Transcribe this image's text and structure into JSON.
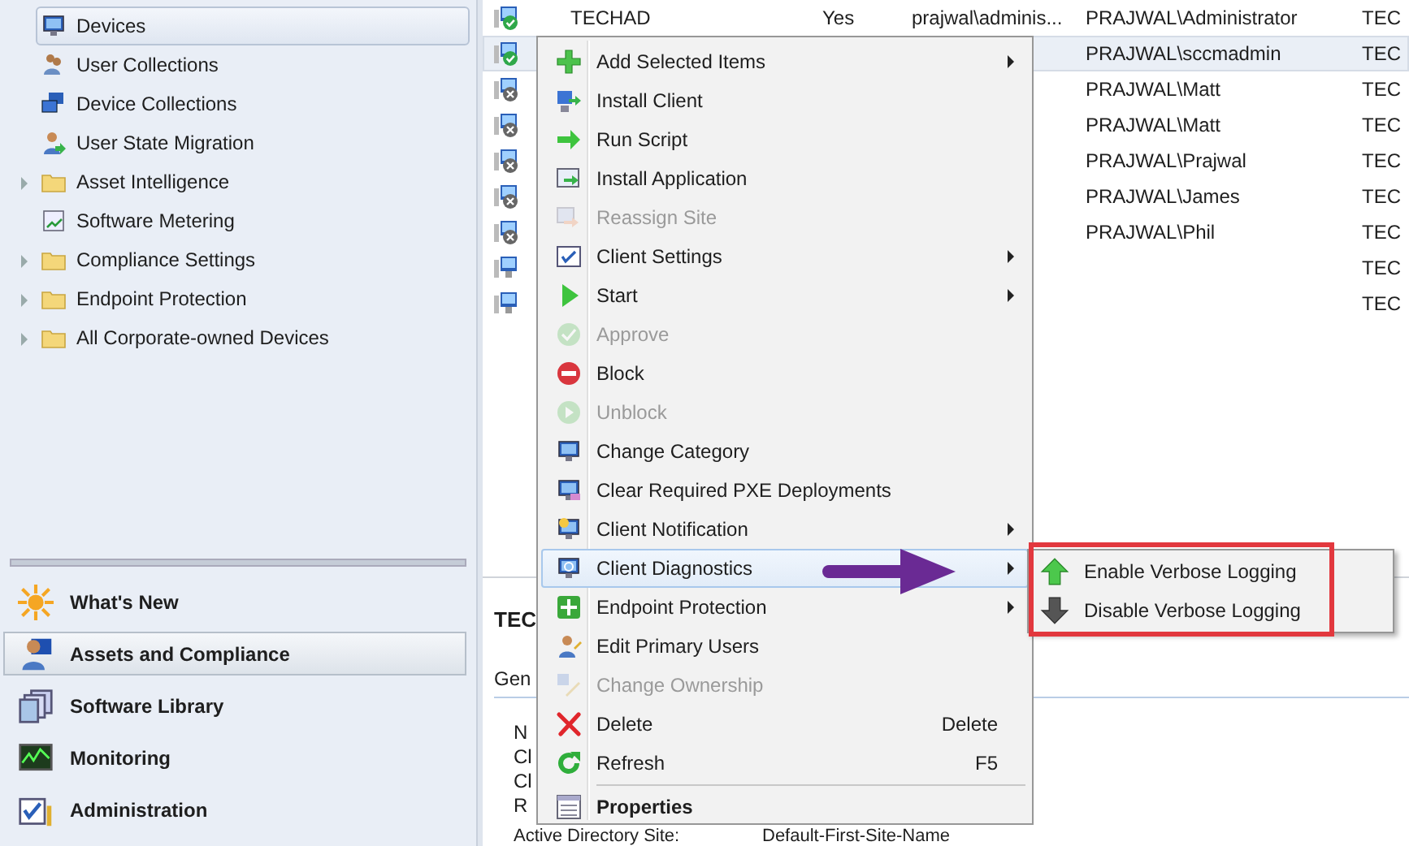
{
  "tree": [
    {
      "label": "Devices",
      "selected": true,
      "expandable": false
    },
    {
      "label": "User Collections",
      "selected": false,
      "expandable": false
    },
    {
      "label": "Device Collections",
      "selected": false,
      "expandable": false
    },
    {
      "label": "User State Migration",
      "selected": false,
      "expandable": false
    },
    {
      "label": "Asset Intelligence",
      "selected": false,
      "expandable": true
    },
    {
      "label": "Software Metering",
      "selected": false,
      "expandable": false
    },
    {
      "label": "Compliance Settings",
      "selected": false,
      "expandable": true
    },
    {
      "label": "Endpoint Protection",
      "selected": false,
      "expandable": true
    },
    {
      "label": "All Corporate-owned Devices",
      "selected": false,
      "expandable": true
    }
  ],
  "workspaces": [
    {
      "label": "What's New",
      "selected": false
    },
    {
      "label": "Assets and Compliance",
      "selected": true
    },
    {
      "label": "Software Library",
      "selected": false
    },
    {
      "label": "Monitoring",
      "selected": false
    },
    {
      "label": "Administration",
      "selected": false
    }
  ],
  "table": {
    "rows": [
      {
        "kind": "ok",
        "selected": false,
        "column_1": "TECHAD",
        "column_2": "Yes",
        "column_3": "prajwal\\adminis...",
        "column_4": "PRAJWAL\\Administrator",
        "column_5": "TEC"
      },
      {
        "kind": "ok",
        "selected": true,
        "column_4": "PRAJWAL\\sccmadmin",
        "column_5": "TEC"
      },
      {
        "kind": "error",
        "selected": false,
        "column_4": "PRAJWAL\\Matt",
        "column_5": "TEC"
      },
      {
        "kind": "error",
        "selected": false,
        "column_4": "PRAJWAL\\Matt",
        "column_5": "TEC"
      },
      {
        "kind": "error",
        "selected": false,
        "column_4": "PRAJWAL\\Prajwal",
        "column_5": "TEC"
      },
      {
        "kind": "error",
        "selected": false,
        "column_4": "PRAJWAL\\James",
        "column_5": "TEC"
      },
      {
        "kind": "error",
        "selected": false,
        "column_4": "PRAJWAL\\Phil",
        "column_5": "TEC"
      },
      {
        "kind": "none",
        "selected": false,
        "column_5": "TEC"
      },
      {
        "kind": "none",
        "selected": false,
        "column_5": "TEC"
      }
    ]
  },
  "details": {
    "title": "TEC",
    "tab": "Gen",
    "fields": [
      {
        "label": "N"
      },
      {
        "label": "Cl"
      },
      {
        "label": "Cl"
      },
      {
        "label": "R"
      },
      {
        "label": "Active Directory Site:",
        "value": "Default-First-Site-Name"
      }
    ]
  },
  "context_menu": {
    "items": [
      {
        "kind": "item",
        "label": "Add Selected Items",
        "disabled": false,
        "submenu": true,
        "selected": false
      },
      {
        "kind": "item",
        "label": "Install Client",
        "disabled": false,
        "submenu": false,
        "selected": false
      },
      {
        "kind": "item",
        "label": "Run Script",
        "disabled": false,
        "submenu": false,
        "selected": false
      },
      {
        "kind": "item",
        "label": "Install Application",
        "disabled": false,
        "submenu": false,
        "selected": false
      },
      {
        "kind": "item",
        "label": "Reassign Site",
        "disabled": true,
        "submenu": false,
        "selected": false
      },
      {
        "kind": "item",
        "label": "Client Settings",
        "disabled": false,
        "submenu": true,
        "selected": false
      },
      {
        "kind": "item",
        "label": "Start",
        "disabled": false,
        "submenu": true,
        "selected": false
      },
      {
        "kind": "item",
        "label": "Approve",
        "disabled": true,
        "submenu": false,
        "selected": false
      },
      {
        "kind": "item",
        "label": "Block",
        "disabled": false,
        "submenu": false,
        "selected": false
      },
      {
        "kind": "item",
        "label": "Unblock",
        "disabled": true,
        "submenu": false,
        "selected": false
      },
      {
        "kind": "item",
        "label": "Change Category",
        "disabled": false,
        "submenu": false,
        "selected": false
      },
      {
        "kind": "item",
        "label": "Clear Required PXE Deployments",
        "disabled": false,
        "submenu": false,
        "selected": false
      },
      {
        "kind": "item",
        "label": "Client Notification",
        "disabled": false,
        "submenu": true,
        "selected": false
      },
      {
        "kind": "item",
        "label": "Client Diagnostics",
        "disabled": false,
        "submenu": true,
        "selected": true
      },
      {
        "kind": "item",
        "label": "Endpoint Protection",
        "disabled": false,
        "submenu": true,
        "selected": false
      },
      {
        "kind": "item",
        "label": "Edit Primary Users",
        "disabled": false,
        "submenu": false,
        "selected": false
      },
      {
        "kind": "item",
        "label": "Change Ownership",
        "disabled": true,
        "submenu": false,
        "selected": false
      },
      {
        "kind": "item",
        "label": "Delete",
        "disabled": false,
        "submenu": false,
        "selected": false,
        "shortcut": "Delete"
      },
      {
        "kind": "item",
        "label": "Refresh",
        "disabled": false,
        "submenu": false,
        "selected": false,
        "shortcut": "F5"
      },
      {
        "kind": "separator"
      },
      {
        "kind": "default",
        "label": "Properties",
        "disabled": false,
        "submenu": false,
        "selected": false
      }
    ]
  },
  "submenu": {
    "items": [
      {
        "label": "Enable Verbose Logging"
      },
      {
        "label": "Disable Verbose Logging"
      }
    ]
  }
}
